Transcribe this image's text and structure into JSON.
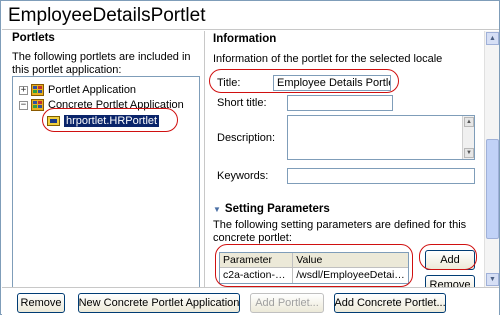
{
  "editor_title": "EmployeeDetailsPortlet",
  "left": {
    "heading": "Portlets",
    "description": "The following portlets are included in this portlet application:",
    "tree": [
      {
        "label": "Portlet Application",
        "expander": "+"
      },
      {
        "label": "Concrete Portlet Application",
        "expander": "−"
      },
      {
        "label": "hrportlet.HRPortlet",
        "selected": true
      }
    ]
  },
  "info": {
    "heading": "Information",
    "description": "Information of the portlet for the selected locale",
    "title_label": "Title:",
    "title_value": "Employee Details Portlet",
    "short_title_label": "Short title:",
    "short_title_value": "",
    "description_label": "Description:",
    "keywords_label": "Keywords:",
    "keywords_value": ""
  },
  "setting_params": {
    "heading": "Setting Parameters",
    "description": "The following setting parameters are defined for this concrete portlet:",
    "columns": [
      "Parameter",
      "Value"
    ],
    "rows": [
      {
        "parameter": "c2a-action-d...",
        "value": "/wsdl/EmployeeDetail..."
      }
    ],
    "add_label": "Add",
    "remove_label": "Remove"
  },
  "bottom_buttons": {
    "remove": "Remove",
    "new_concrete_app": "New Concrete Portlet Application",
    "add_portlet": "Add Portlet...",
    "add_concrete_portlet": "Add Concrete Portlet..."
  },
  "colors": {
    "selection": "#0a246a",
    "annotation": "#d01010",
    "section_triangle": "#4a6fa5"
  }
}
